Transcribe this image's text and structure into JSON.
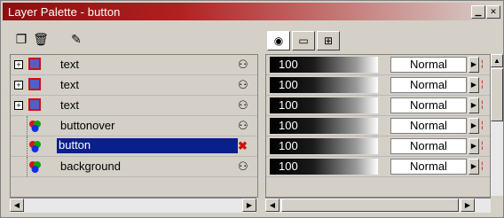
{
  "window": {
    "title": "Layer Palette - button",
    "minimize_icon": "minimize-icon",
    "close_icon": "close-icon"
  },
  "toolbar": [
    {
      "name": "new-layer-button",
      "icon": "new-layer-icon",
      "glyph": "❐"
    },
    {
      "name": "delete-layer-button",
      "icon": "trash-icon",
      "glyph": "🗑"
    },
    {
      "name": "layer-properties-button",
      "icon": "layer-properties-icon",
      "glyph": "✎"
    }
  ],
  "tabs": [
    {
      "name": "tab-layer-opacity",
      "icon": "opacity-icon",
      "glyph": "◉",
      "active": true
    },
    {
      "name": "tab-layer-group",
      "icon": "group-icon",
      "glyph": "▭",
      "active": false
    },
    {
      "name": "tab-layer-links",
      "icon": "links-icon",
      "glyph": "⊞",
      "active": false
    }
  ],
  "layers": [
    {
      "name": "text",
      "type": "frame",
      "expandable": true,
      "visible": true,
      "selected": false,
      "opacity": "100",
      "blend": "Normal"
    },
    {
      "name": "text",
      "type": "frame",
      "expandable": true,
      "visible": true,
      "selected": false,
      "opacity": "100",
      "blend": "Normal"
    },
    {
      "name": "text",
      "type": "frame",
      "expandable": true,
      "visible": true,
      "selected": false,
      "opacity": "100",
      "blend": "Normal"
    },
    {
      "name": "buttonover",
      "type": "raster",
      "expandable": false,
      "visible": true,
      "selected": false,
      "opacity": "100",
      "blend": "Normal"
    },
    {
      "name": "button",
      "type": "raster",
      "expandable": false,
      "visible": false,
      "selected": true,
      "opacity": "100",
      "blend": "Normal"
    },
    {
      "name": "background",
      "type": "raster",
      "expandable": false,
      "visible": true,
      "selected": false,
      "opacity": "100",
      "blend": "Normal"
    }
  ],
  "colors": {
    "title_start": "#8a1010",
    "selection": "#0a1e8c",
    "hidden_eye": "#d01010"
  }
}
